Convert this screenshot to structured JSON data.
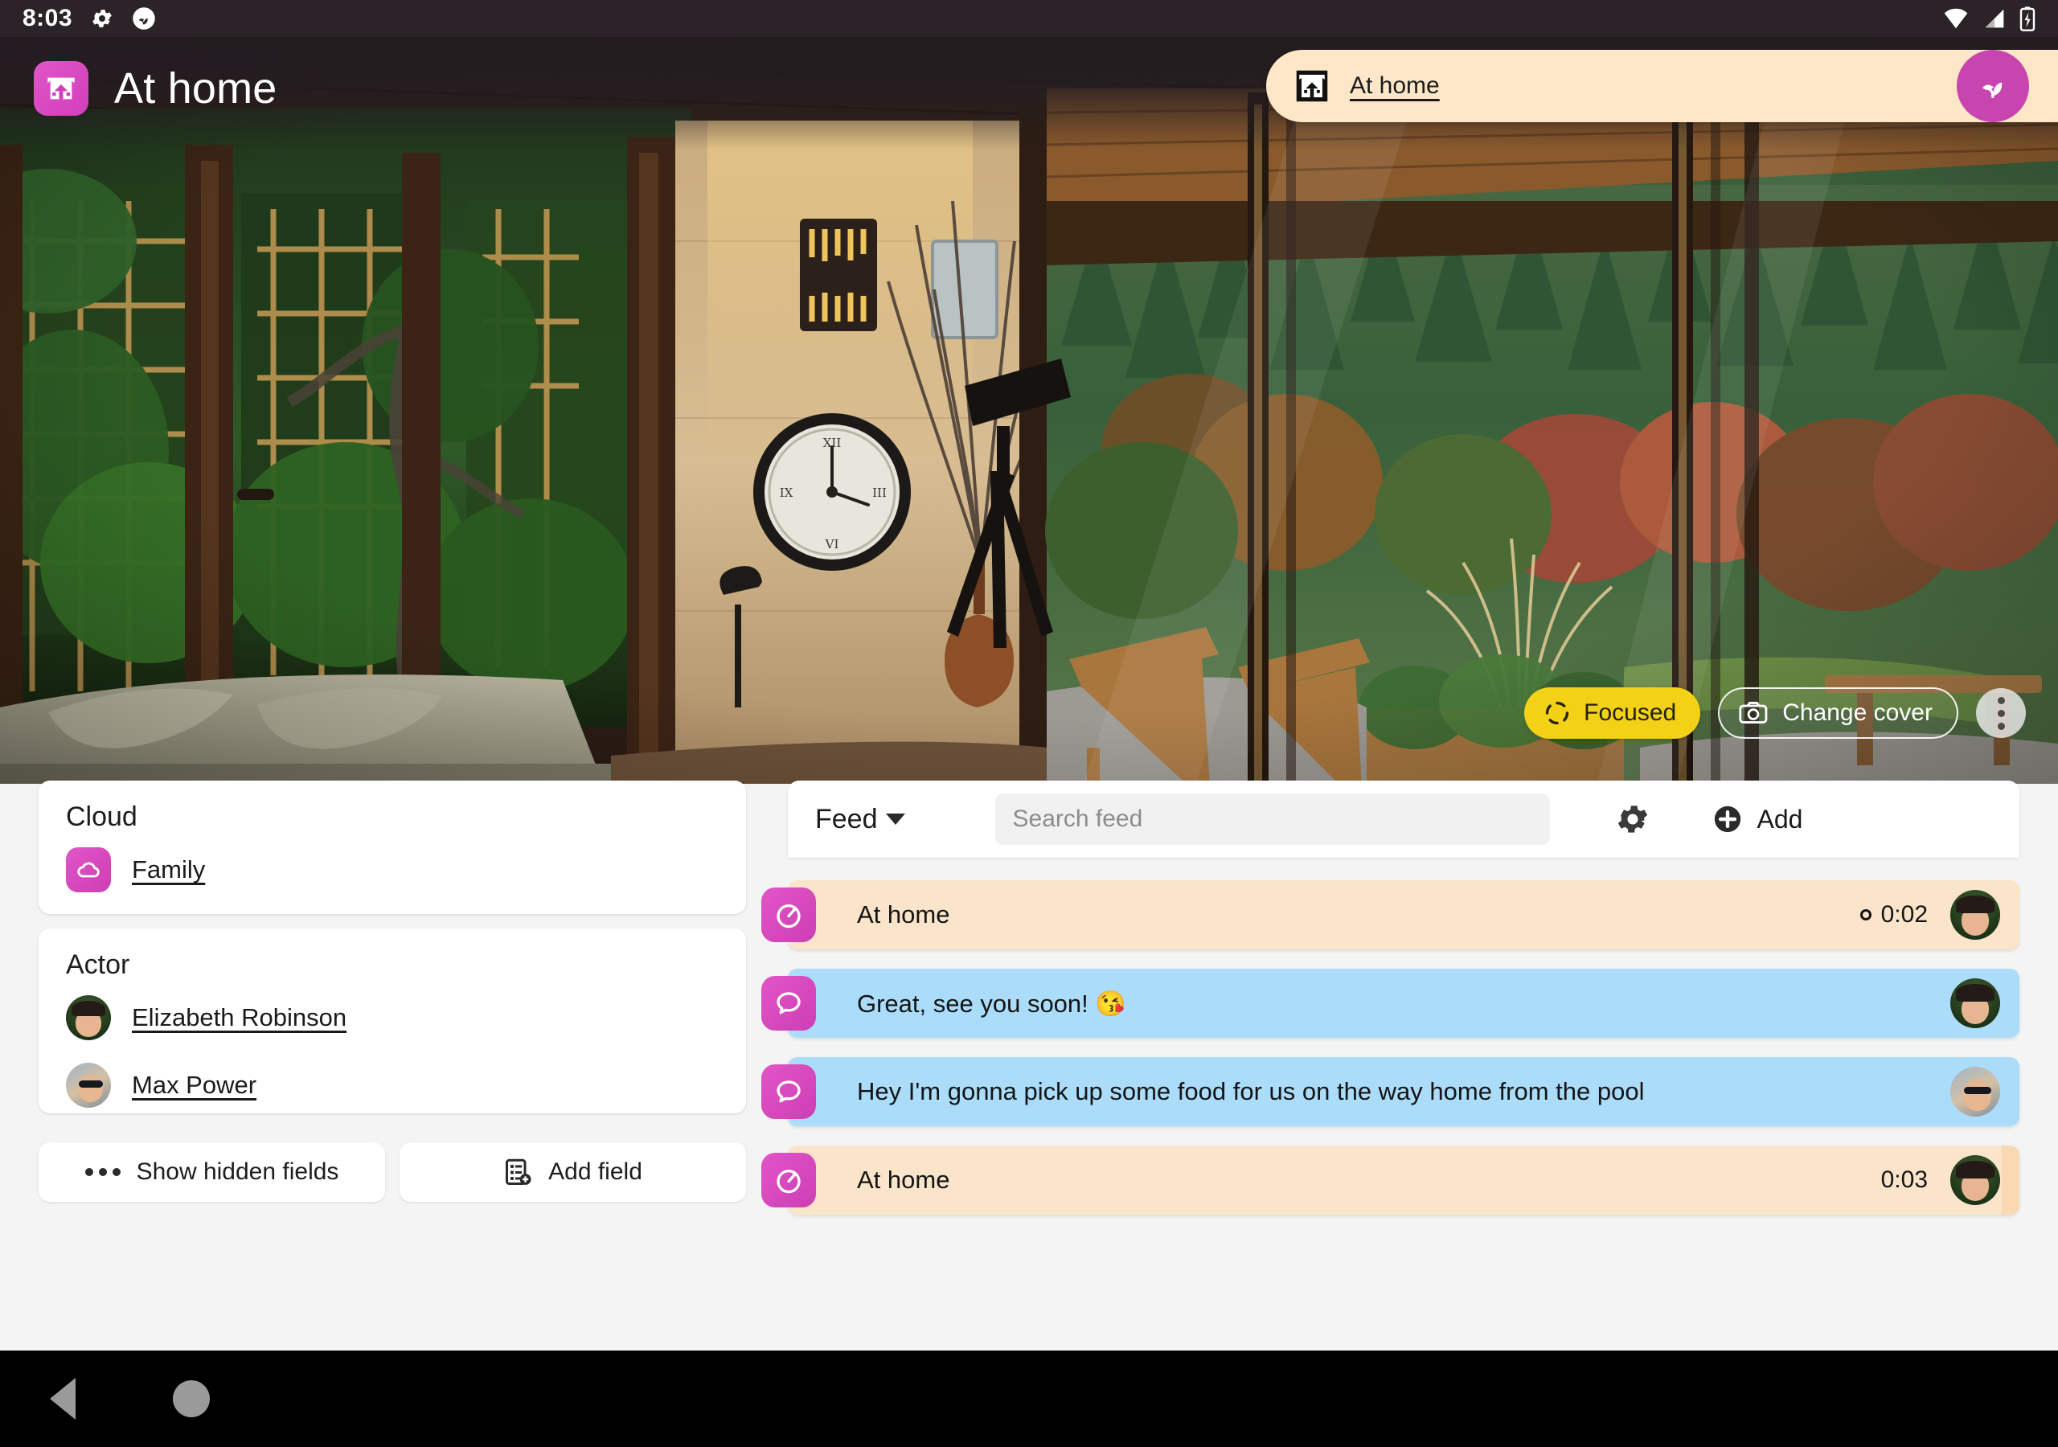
{
  "status_bar": {
    "time": "8:03",
    "left_icons": [
      "gear-icon",
      "sprout-badge-icon"
    ],
    "right_icons": [
      "wifi-icon",
      "cellular-signal-icon",
      "battery-charging-icon"
    ]
  },
  "app_bar": {
    "icon": "home-app-icon",
    "title": "At home"
  },
  "top_pill": {
    "icon": "home-thumbnail-icon",
    "link_label": "At home",
    "avatar_icon": "sprout-avatar-icon",
    "avatar_color": "#c845b0"
  },
  "cover": {
    "focused_badge": {
      "label": "Focused",
      "icon": "focus-target-icon",
      "color": "#f2d116"
    },
    "change_cover_button": {
      "label": "Change cover",
      "icon": "camera-icon"
    },
    "overflow_button": {
      "icon": "more-vertical-icon"
    }
  },
  "detail_panel": {
    "cards": [
      {
        "title": "Cloud",
        "rows": [
          {
            "icon": "cloud-icon",
            "icon_kind": "square",
            "label": "Family"
          }
        ]
      },
      {
        "title": "Actor",
        "rows": [
          {
            "icon": "avatar-elizabeth",
            "icon_kind": "avatar",
            "avatar_style": "eliz",
            "label": "Elizabeth Robinson"
          },
          {
            "icon": "avatar-max",
            "icon_kind": "avatar",
            "avatar_style": "max",
            "label": "Max Power"
          }
        ]
      }
    ],
    "buttons": [
      {
        "label": "Show hidden fields",
        "icon": "ellipsis-icon"
      },
      {
        "label": "Add field",
        "icon": "add-field-icon"
      }
    ]
  },
  "feed": {
    "header": {
      "label": "Feed",
      "dropdown_icon": "chevron-down-icon",
      "search_placeholder": "Search feed",
      "search_value": "",
      "settings_icon": "gear-icon",
      "add_label": "Add",
      "add_icon": "plus-circle-icon"
    },
    "items": [
      {
        "icon": "stopwatch-icon",
        "text": "At home",
        "time": "0:02",
        "has_dot_indicator": true,
        "color": "#fae5ca",
        "avatar_style": "eliz",
        "avatar_name": "avatar-elizabeth"
      },
      {
        "icon": "chat-bubble-icon",
        "text": "Great, see you soon! 😘",
        "time": "",
        "has_dot_indicator": false,
        "color": "#abddfb",
        "avatar_style": "eliz",
        "avatar_name": "avatar-elizabeth"
      },
      {
        "icon": "chat-bubble-icon",
        "text": "Hey I'm gonna pick up some food for us on the way home from the pool",
        "time": "",
        "has_dot_indicator": false,
        "color": "#abddfb",
        "avatar_style": "max",
        "avatar_name": "avatar-max"
      },
      {
        "icon": "stopwatch-icon",
        "text": "At home",
        "time": "0:03",
        "has_dot_indicator": false,
        "color": "#fae5ca",
        "avatar_style": "eliz",
        "avatar_name": "avatar-elizabeth"
      }
    ]
  },
  "nav_bar": {
    "back_icon": "back-triangle-icon",
    "home_icon": "home-circle-icon"
  }
}
